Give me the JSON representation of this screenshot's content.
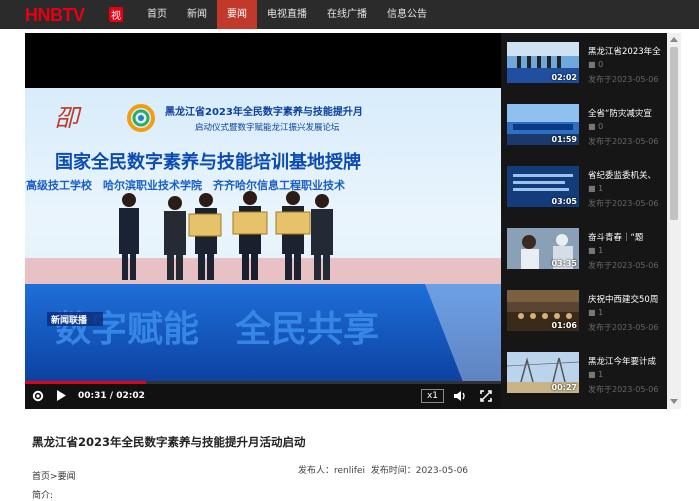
{
  "header": {
    "logo_text": "HNBTV",
    "nav": [
      {
        "label": "首页",
        "active": false
      },
      {
        "label": "新闻",
        "active": false
      },
      {
        "label": "要闻",
        "active": true
      },
      {
        "label": "电视直播",
        "active": false
      },
      {
        "label": "在线广播",
        "active": false
      },
      {
        "label": "信息公告",
        "active": false
      }
    ]
  },
  "video": {
    "banner_line1": "黑龙江省2023年全民数字素养与技能提升月",
    "banner_line2": "启动仪式暨数字赋能龙江振兴发展论坛",
    "headline": "国家全民数字素养与技能培训基地授牌",
    "subline": "省高级技工学校　哈尔滨职业技术学院　齐齐哈尔信息工程职业技术",
    "stage_text": "数字赋能　全民共享",
    "caption_tag": "新闻联播",
    "current_time": "00:31",
    "duration": "02:02",
    "time_display": "00:31 / 02:02",
    "progress": 0.254,
    "speed": "x1"
  },
  "playlist": [
    {
      "title": "黑龙江省2023年全",
      "views": "0",
      "date": "发布于2023-05-06",
      "duration": "02:02"
    },
    {
      "title": "全省“防灾减灾宣",
      "views": "0",
      "date": "发布于2023-05-06",
      "duration": "01:59"
    },
    {
      "title": "省纪委监委机关、",
      "views": "1",
      "date": "发布于2023-05-06",
      "duration": "03:05"
    },
    {
      "title": "奋斗青春｜“题",
      "views": "1",
      "date": "发布于2023-05-06",
      "duration": "03:35"
    },
    {
      "title": "庆祝中西建交50周",
      "views": "1",
      "date": "发布于2023-05-06",
      "duration": "01:06"
    },
    {
      "title": "黑龙江今年要计成",
      "views": "1",
      "date": "发布于2023-05-06",
      "duration": "00:27"
    }
  ],
  "article": {
    "title": "黑龙江省2023年全民数字素养与技能提升月活动启动",
    "crumb_home": "首页",
    "crumb_sep": ">",
    "crumb_section": "要闻",
    "publisher_label": "发布人：",
    "publisher": "renlifei",
    "time_label": "发布时间：",
    "time": "2023-05-06",
    "intro_label": "简介:"
  },
  "colors": {
    "topbar": "#2b2b2b",
    "accent": "#c0392b",
    "progress": "#e60012",
    "playlist_bg": "#161616"
  }
}
